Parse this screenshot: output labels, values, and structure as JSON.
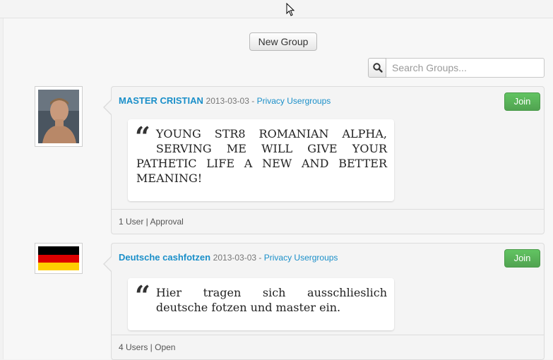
{
  "toolbar": {
    "new_group_label": "New Group"
  },
  "search": {
    "placeholder": "Search Groups..."
  },
  "groups": [
    {
      "name": "MASTER CRISTIAN",
      "date": "2013-03-03",
      "separator": " - ",
      "category": "Privacy Usergroups",
      "join_label": "Join",
      "description": "YOUNG STR8 ROMANIAN ALPHA, SERVING ME WILL GIVE YOUR PATHETIC LIFE A NEW AND BETTER MEANING!",
      "footer": "1 User | Approval"
    },
    {
      "name": "Deutsche cashfotzen",
      "date": "2013-03-03",
      "separator": " - ",
      "category": "Privacy Usergroups",
      "join_label": "Join",
      "description": "Hier tragen sich ausschlieslich deutsche fotzen und master ein.",
      "footer": "4 Users | Open"
    }
  ]
}
